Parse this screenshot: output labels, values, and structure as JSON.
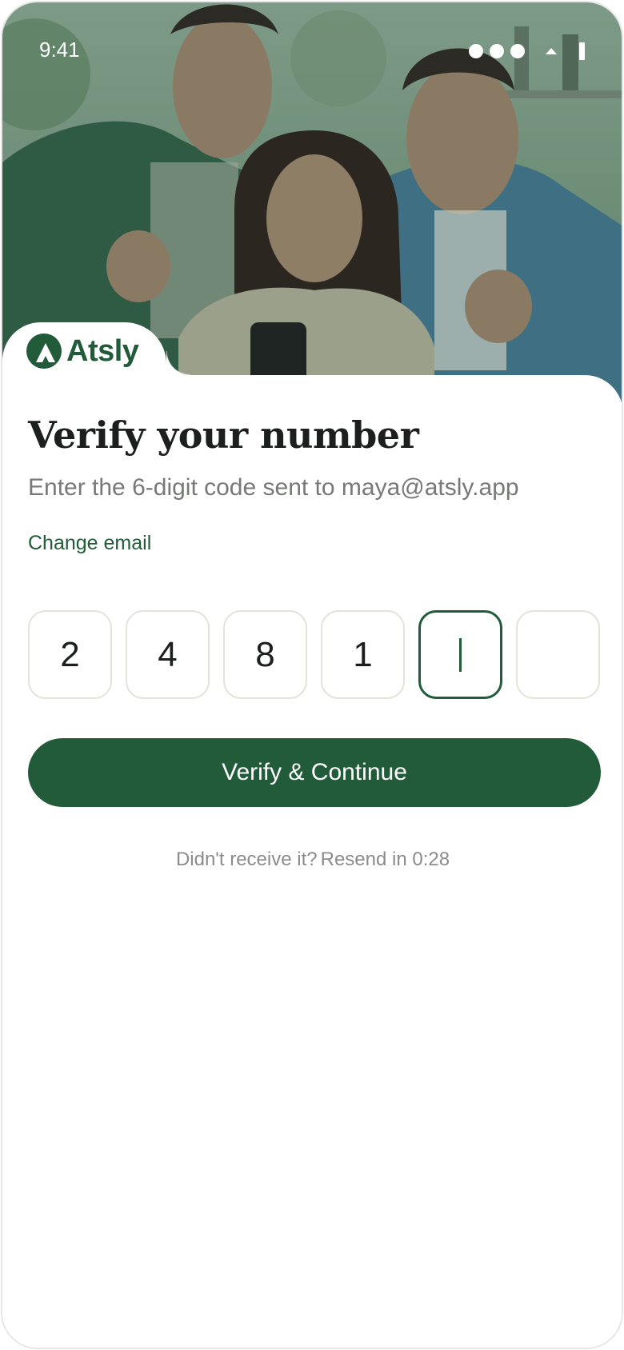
{
  "status_bar": {
    "time": "9:41"
  },
  "brand": {
    "name": "Atsly",
    "accent": "#215b39"
  },
  "hero": {
    "image": "three smiling friends looking at a phone",
    "tint": "#3d6b47"
  },
  "screen": {
    "title": "Verify your number",
    "subtitle": "Enter the 6-digit code sent to maya@atsly.app",
    "change_email_label": "Change email"
  },
  "otp": {
    "digits": [
      "2",
      "4",
      "8",
      "1",
      "",
      ""
    ],
    "active_index": 4
  },
  "actions": {
    "primary_label": "Verify & Continue"
  },
  "resend": {
    "prompt": "Didn't receive it?",
    "countdown": "Resend in 0:28"
  }
}
